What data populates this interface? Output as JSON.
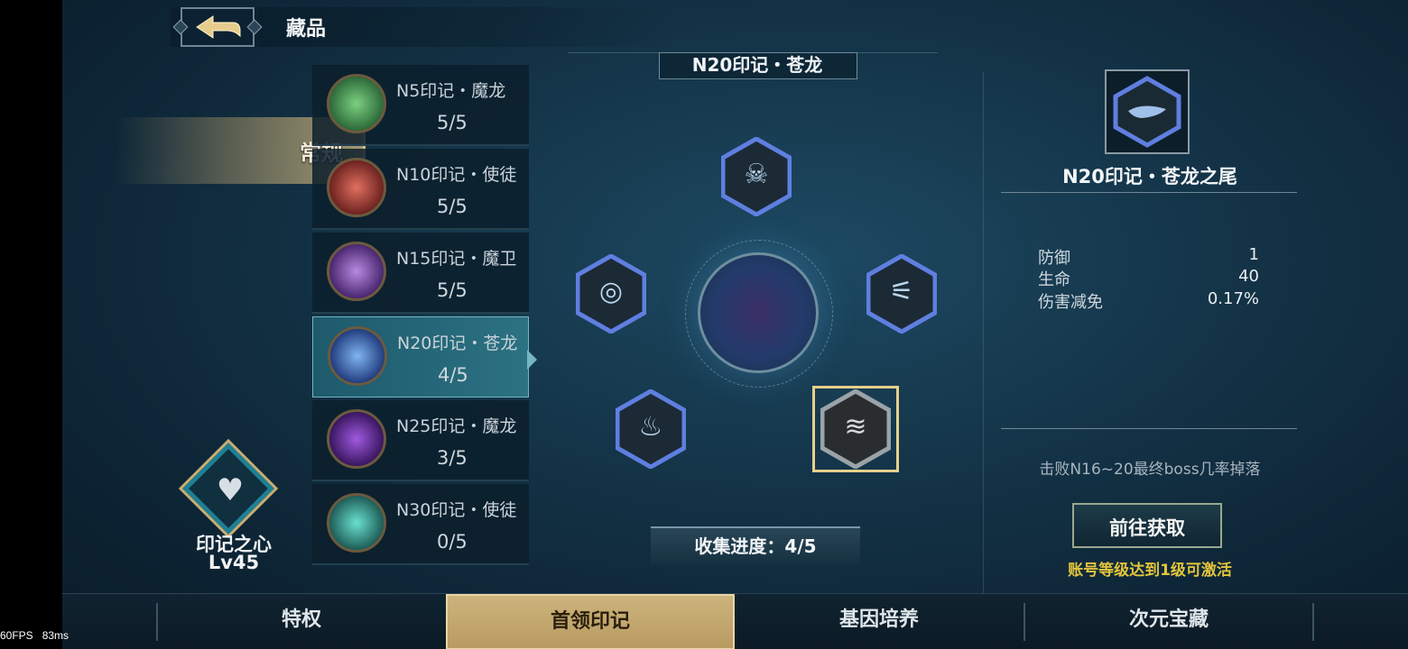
{
  "header": {
    "title": "藏品"
  },
  "category": {
    "label": "常规"
  },
  "marks": [
    {
      "name": "N5印记・魔龙",
      "progress": "5/5",
      "color": "#3c9a4e"
    },
    {
      "name": "N10印记・使徒",
      "progress": "5/5",
      "color": "#b8433c"
    },
    {
      "name": "N15印记・魔卫",
      "progress": "5/5",
      "color": "#7a4aa8"
    },
    {
      "name": "N20印记・苍龙",
      "progress": "4/5",
      "color": "#3f6fc4"
    },
    {
      "name": "N25印记・魔龙",
      "progress": "3/5",
      "color": "#6a2fa8"
    },
    {
      "name": "N30印记・使徒",
      "progress": "0/5",
      "color": "#2f9c8e"
    }
  ],
  "heart": {
    "label": "印记之心",
    "level": "Lv45"
  },
  "set": {
    "title": "N20印记・苍龙",
    "progress": "收集进度：4/5"
  },
  "detail": {
    "name": "N20印记・苍龙之尾",
    "stats": [
      {
        "label": "防御",
        "value": "1"
      },
      {
        "label": "生命",
        "value": "40"
      },
      {
        "label": "伤害减免",
        "value": "0.17%"
      }
    ],
    "source": "击败N16~20最终boss几率掉落",
    "button": "前往获取",
    "note": "账号等级达到1级可激活"
  },
  "nav": {
    "tabs": [
      "特权",
      "首领印记",
      "基因培养",
      "次元宝藏"
    ],
    "active": "首领印记"
  },
  "debug": {
    "fps": "60FPS",
    "ms": "83ms"
  },
  "colors": {
    "accent_gold": "#d7bd84",
    "highlight_yellow": "#e3c43c",
    "slot_blue": "#4a6fd0"
  }
}
